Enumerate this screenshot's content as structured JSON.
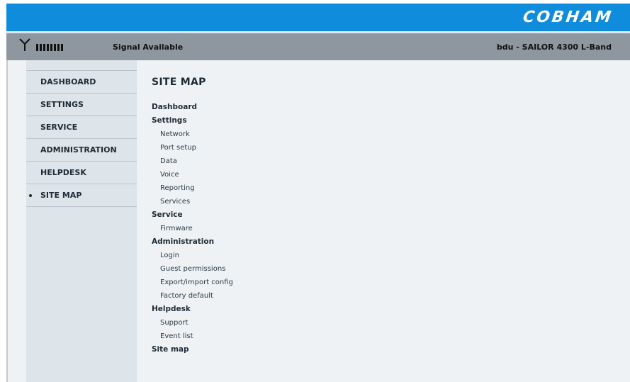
{
  "header": {
    "logo": "COBHAM",
    "signal_text": "Signal Available",
    "device_text": "bdu - SAILOR 4300 L-Band",
    "signal_bars": 8
  },
  "sidebar": {
    "items": [
      {
        "label": "DASHBOARD",
        "active": false
      },
      {
        "label": "SETTINGS",
        "active": false
      },
      {
        "label": "SERVICE",
        "active": false
      },
      {
        "label": "ADMINISTRATION",
        "active": false
      },
      {
        "label": "HELPDESK",
        "active": false
      },
      {
        "label": "SITE MAP",
        "active": true
      }
    ]
  },
  "main": {
    "title": "SITE MAP",
    "sections": [
      {
        "label": "Dashboard",
        "items": []
      },
      {
        "label": "Settings",
        "items": [
          "Network",
          "Port setup",
          "Data",
          "Voice",
          "Reporting",
          "Services"
        ]
      },
      {
        "label": "Service",
        "items": [
          "Firmware"
        ]
      },
      {
        "label": "Administration",
        "items": [
          "Login",
          "Guest permissions",
          "Export/import config",
          "Factory default"
        ]
      },
      {
        "label": "Helpdesk",
        "items": [
          "Support",
          "Event list"
        ]
      },
      {
        "label": "Site map",
        "items": []
      }
    ]
  },
  "colors": {
    "topbar": "#0f8ddc",
    "statusbar": "#8e979f",
    "sidebar": "#dde4ea",
    "content": "#eef2f5"
  }
}
